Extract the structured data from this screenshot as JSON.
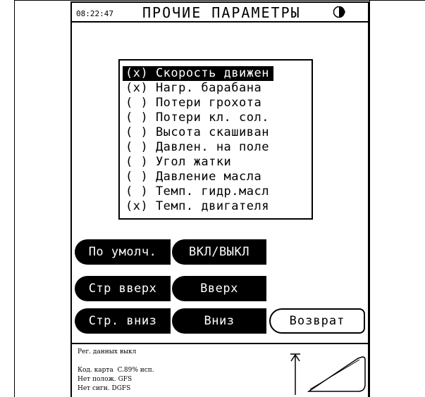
{
  "header": {
    "time": "08:22:47",
    "title": "ПРОЧИЕ ПАРАМЕТРЫ",
    "icon": "day-night-icon"
  },
  "params": {
    "items": [
      {
        "label": "(x) Скорость движен",
        "selected": true
      },
      {
        "label": "(x) Нагр. барабана",
        "selected": false
      },
      {
        "label": "( ) Потери грохота",
        "selected": false
      },
      {
        "label": "( ) Потери кл. сол.",
        "selected": false
      },
      {
        "label": "( ) Высота скашиван",
        "selected": false
      },
      {
        "label": "( ) Давлен. на поле",
        "selected": false
      },
      {
        "label": "( ) Угол жатки",
        "selected": false
      },
      {
        "label": "( ) Давление масла",
        "selected": false
      },
      {
        "label": "( ) Темп. гидр.масл",
        "selected": false
      },
      {
        "label": "(x) Темп. двигателя",
        "selected": false
      }
    ]
  },
  "buttons": {
    "default": "По умолч.",
    "on_off": "ВКЛ/ВЫКЛ",
    "page_up": "Стр вверх",
    "up": "Вверх",
    "page_down": "Стр. вниз",
    "down": "Вниз",
    "back": "Возврат"
  },
  "status": {
    "logging": "Рег. данных выкл",
    "card": "Код. карта  C.89% исп.",
    "position": "Нет полож. GFS",
    "signal": "Нет сигн. DGFS"
  },
  "colors": {
    "foreground": "#000000",
    "background": "#ffffff"
  }
}
